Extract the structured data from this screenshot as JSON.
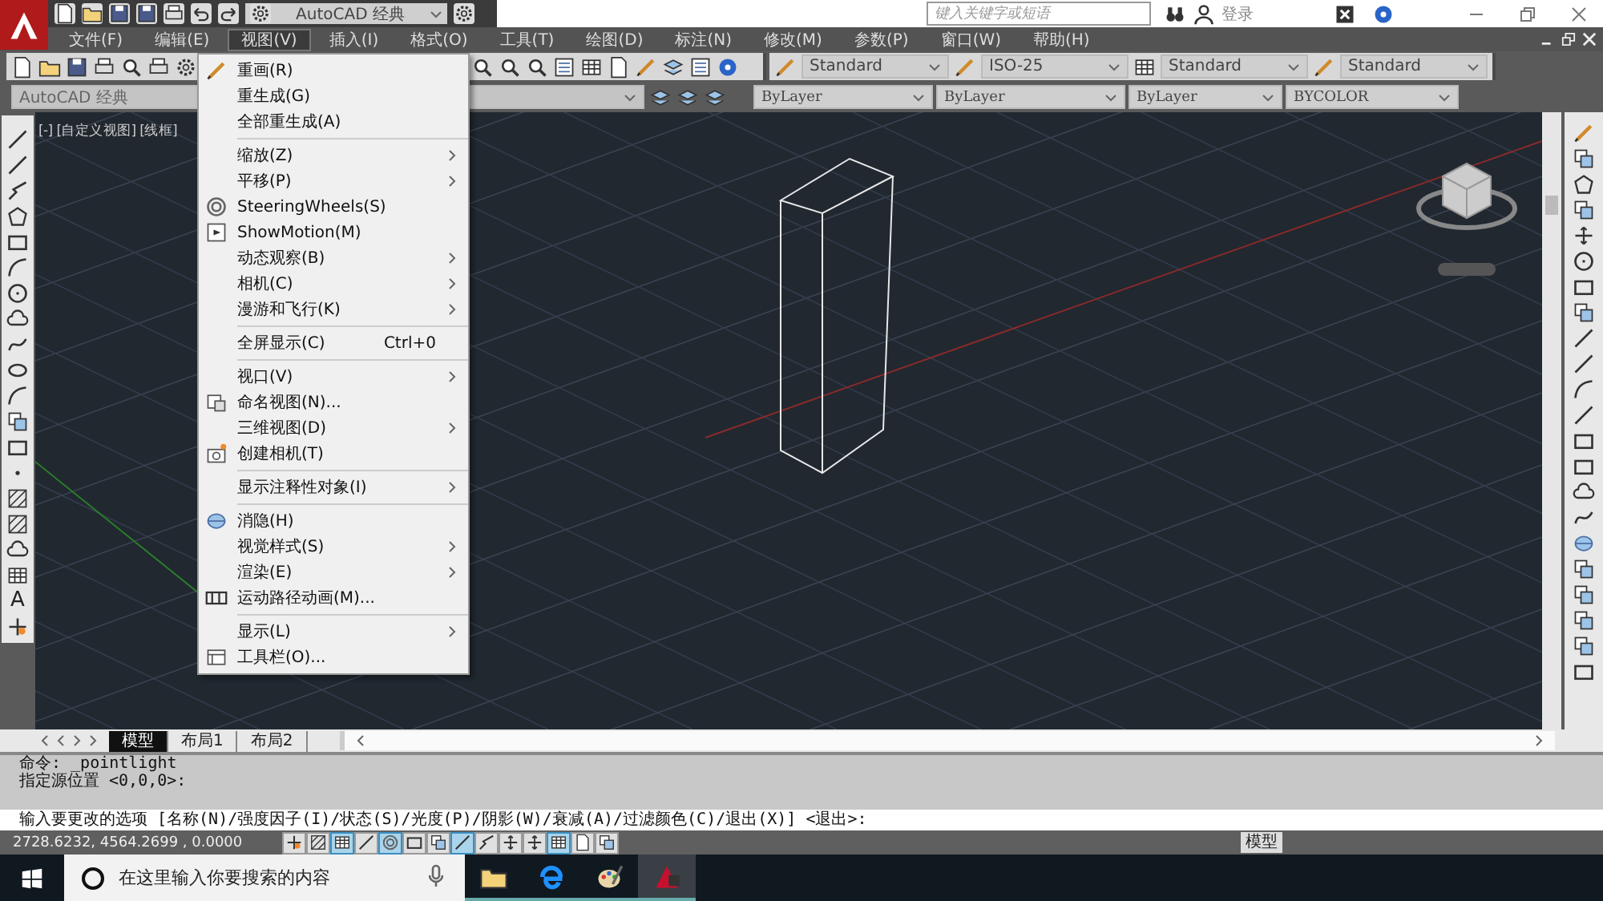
{
  "title_bar": {
    "workspace": "AutoCAD 经典",
    "search": {
      "placeholder": "键入关键字或短语"
    },
    "sign_in": "登录"
  },
  "menu_bar": [
    {
      "label": "文件(F)",
      "selected": false
    },
    {
      "label": "编辑(E)",
      "selected": false
    },
    {
      "label": "视图(V)",
      "selected": true
    },
    {
      "label": "插入(I)",
      "selected": false
    },
    {
      "label": "格式(O)",
      "selected": false
    },
    {
      "label": "工具(T)",
      "selected": false
    },
    {
      "label": "绘图(D)",
      "selected": false
    },
    {
      "label": "标注(N)",
      "selected": false
    },
    {
      "label": "修改(M)",
      "selected": false
    },
    {
      "label": "参数(P)",
      "selected": false
    },
    {
      "label": "窗口(W)",
      "selected": false
    },
    {
      "label": "帮助(H)",
      "selected": false
    }
  ],
  "styles_toolbar": {
    "text_style": "Standard",
    "dim_style": "ISO-25",
    "table_style": "Standard",
    "multileader_style": "Standard"
  },
  "properties_bar": {
    "workspace": "AutoCAD 经典",
    "color_control": "ByLayer",
    "linetype": "ByLayer",
    "lineweight": "ByLayer",
    "plot_style": "BYCOLOR"
  },
  "viewport": {
    "label": "[-] [自定义视图] [线框]"
  },
  "view_menu": [
    {
      "kind": "item",
      "label": "重画(R)",
      "submenu": false
    },
    {
      "kind": "item",
      "label": "重生成(G)",
      "submenu": false
    },
    {
      "kind": "item",
      "label": "全部重生成(A)",
      "submenu": false
    },
    {
      "kind": "separator"
    },
    {
      "kind": "item",
      "label": "缩放(Z)",
      "submenu": true
    },
    {
      "kind": "item",
      "label": "平移(P)",
      "submenu": true
    },
    {
      "kind": "item",
      "label": "SteeringWheels(S)",
      "submenu": false
    },
    {
      "kind": "item",
      "label": "ShowMotion(M)",
      "submenu": false
    },
    {
      "kind": "item",
      "label": "动态观察(B)",
      "submenu": true
    },
    {
      "kind": "item",
      "label": "相机(C)",
      "submenu": true
    },
    {
      "kind": "item",
      "label": "漫游和飞行(K)",
      "submenu": true
    },
    {
      "kind": "separator"
    },
    {
      "kind": "item",
      "label": "全屏显示(C)",
      "shortcut": "Ctrl+0",
      "submenu": false
    },
    {
      "kind": "separator"
    },
    {
      "kind": "item",
      "label": "视口(V)",
      "submenu": true
    },
    {
      "kind": "item",
      "label": "命名视图(N)...",
      "submenu": false
    },
    {
      "kind": "item",
      "label": "三维视图(D)",
      "submenu": true
    },
    {
      "kind": "item",
      "label": "创建相机(T)",
      "submenu": false
    },
    {
      "kind": "separator"
    },
    {
      "kind": "item",
      "label": "显示注释性对象(I)",
      "submenu": true
    },
    {
      "kind": "separator"
    },
    {
      "kind": "item",
      "label": "消隐(H)",
      "submenu": false
    },
    {
      "kind": "item",
      "label": "视觉样式(S)",
      "submenu": true
    },
    {
      "kind": "item",
      "label": "渲染(E)",
      "submenu": true
    },
    {
      "kind": "item",
      "label": "运动路径动画(M)...",
      "submenu": false
    },
    {
      "kind": "separator"
    },
    {
      "kind": "item",
      "label": "显示(L)",
      "submenu": true
    },
    {
      "kind": "item",
      "label": "工具栏(O)...",
      "submenu": false
    }
  ],
  "draw_toolbar": {
    "text_glyph": "A"
  },
  "layout_tabs": [
    {
      "label": "模型",
      "selected": true
    },
    {
      "label": "布局1",
      "selected": false
    },
    {
      "label": "布局2",
      "selected": false
    }
  ],
  "command_lines": [
    "命令: _pointlight",
    "指定源位置 <0,0,0>:"
  ],
  "command_input": {
    "value": "输入要更改的选项 [名称(N)/强度因子(I)/状态(S)/光度(P)/阴影(W)/衰减(A)/过滤颜色(C)/退出(X)] <退出>:"
  },
  "status_bar": {
    "coordinates": "2728.6232, 4564.2699 , 0.0000",
    "toggles": [
      {
        "on": false
      },
      {
        "on": false
      },
      {
        "on": true
      },
      {
        "on": false
      },
      {
        "on": true
      },
      {
        "on": false
      },
      {
        "on": false
      },
      {
        "on": true
      },
      {
        "on": false
      },
      {
        "on": false
      },
      {
        "on": false
      },
      {
        "on": true
      },
      {
        "on": false
      },
      {
        "on": false
      }
    ],
    "space": "模型"
  },
  "taskbar": {
    "search": {
      "placeholder": "在这里输入你要搜索的内容"
    },
    "apps": [
      {
        "kind": "folder",
        "selected": false
      },
      {
        "kind": "edge",
        "selected": false
      },
      {
        "kind": "paint",
        "selected": false
      },
      {
        "kind": "autocad",
        "selected": true
      }
    ]
  }
}
